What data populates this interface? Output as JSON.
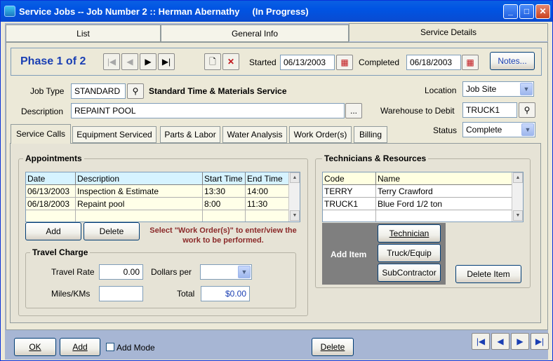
{
  "window": {
    "title": "Service Jobs -- Job Number 2 :: Herman Abernathy     (In Progress)",
    "minimize": "_",
    "maximize": "□",
    "close": "✕"
  },
  "tabs": [
    {
      "label": "List"
    },
    {
      "label": "General Info"
    },
    {
      "label": "Service Details"
    }
  ],
  "phase": {
    "label": "Phase 1 of  2",
    "started_label": "Started",
    "started_value": "06/13/2003",
    "completed_label": "Completed",
    "completed_value": "06/18/2003",
    "notes_button": "Notes..."
  },
  "job": {
    "job_type_label": "Job Type",
    "job_type_value": "STANDARD",
    "job_type_desc": "Standard Time & Materials Service",
    "description_label": "Description",
    "description_value": "REPAINT POOL",
    "lookup_button": "...",
    "location_label": "Location",
    "location_value": "Job Site",
    "warehouse_label": "Warehouse to Debit",
    "warehouse_value": "TRUCK1",
    "status_label": "Status",
    "status_value": "Complete"
  },
  "subtabs": [
    {
      "label": "Service Calls"
    },
    {
      "label": "Equipment Serviced"
    },
    {
      "label": "Parts & Labor"
    },
    {
      "label": "Water Analysis"
    },
    {
      "label": "Work Order(s)"
    },
    {
      "label": "Billing"
    }
  ],
  "appointments": {
    "title": "Appointments",
    "columns": [
      "Date",
      "Description",
      "Start Time",
      "End Time"
    ],
    "rows": [
      [
        "06/13/2003",
        "Inspection & Estimate",
        "13:30",
        "14:00"
      ],
      [
        "06/18/2003",
        "Repaint pool",
        "8:00",
        "11:30"
      ]
    ],
    "add_button": "Add",
    "delete_button": "Delete",
    "note": "Select \"Work Order(s)\" to enter/view the work to be performed."
  },
  "travel": {
    "title": "Travel Charge",
    "rate_label": "Travel Rate",
    "rate_value": "0.00",
    "dollars_per_label": "Dollars per",
    "dollars_per_value": "",
    "miles_label": "Miles/KMs",
    "miles_value": "",
    "total_label": "Total",
    "total_value": "$0.00"
  },
  "technicians": {
    "title": "Technicians & Resources",
    "columns": [
      "Code",
      "Name"
    ],
    "rows": [
      [
        "TERRY",
        "Terry Crawford"
      ],
      [
        "TRUCK1",
        "Blue Ford 1/2 ton"
      ]
    ],
    "add_item_label": "Add Item",
    "technician_button": "Technician",
    "truck_button": "Truck/Equip",
    "subcontractor_button": "SubContractor",
    "delete_item_button": "Delete Item"
  },
  "footer": {
    "ok_button": "OK",
    "add_button": "Add",
    "add_mode_label": "Add Mode",
    "delete_button": "Delete"
  }
}
